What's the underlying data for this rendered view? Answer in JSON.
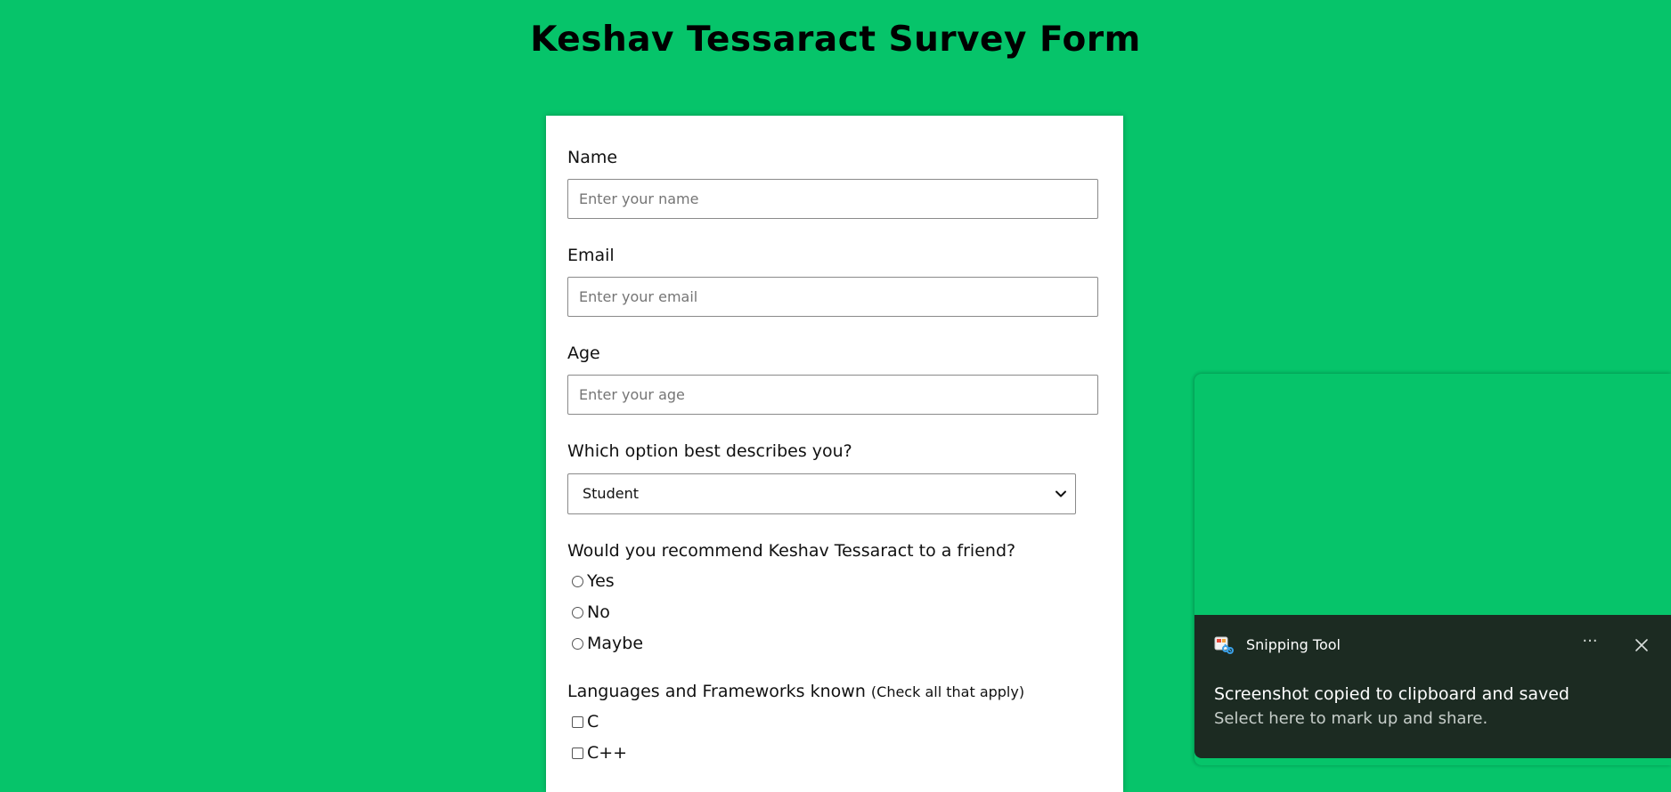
{
  "page": {
    "title": "Keshav Tessaract Survey Form",
    "background_color": "#06c46a"
  },
  "form": {
    "name": {
      "label": "Name",
      "placeholder": "Enter your name",
      "value": ""
    },
    "email": {
      "label": "Email",
      "placeholder": "Enter your email",
      "value": ""
    },
    "age": {
      "label": "Age",
      "placeholder": "Enter your age",
      "value": ""
    },
    "role": {
      "label": "Which option best describes you?",
      "selected": "Student"
    },
    "recommend": {
      "label": "Would you recommend Keshav Tessaract to a friend?",
      "options": [
        "Yes",
        "No",
        "Maybe"
      ]
    },
    "languages": {
      "label": "Languages and Frameworks known",
      "hint": "(Check all that apply)",
      "options": [
        "C",
        "C++"
      ]
    }
  },
  "toast": {
    "app_name": "Snipping Tool",
    "title": "Screenshot copied to clipboard and saved",
    "body": "Select here to mark up and share.",
    "more_label": "···",
    "background_color": "#1c2b22",
    "icons": [
      "snipping-tool-icon",
      "more-options-icon",
      "close-icon"
    ]
  }
}
